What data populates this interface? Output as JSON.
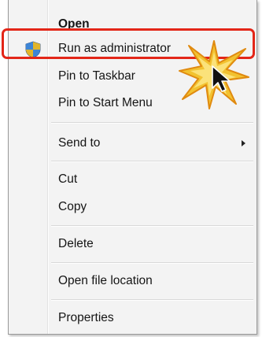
{
  "context_menu": {
    "items": [
      {
        "label": "Open"
      },
      {
        "label": "Run as administrator",
        "icon": "uac-shield-icon"
      },
      {
        "label": "Pin to Taskbar"
      },
      {
        "label": "Pin to Start Menu"
      },
      {
        "label": "Send to",
        "has_submenu": true
      },
      {
        "label": "Cut"
      },
      {
        "label": "Copy"
      },
      {
        "label": "Delete"
      },
      {
        "label": "Open file location"
      },
      {
        "label": "Properties"
      }
    ]
  },
  "annotation": {
    "highlight_color": "#e32618",
    "burst_color": "#f2c230",
    "burst_outline": "#e08a10"
  }
}
